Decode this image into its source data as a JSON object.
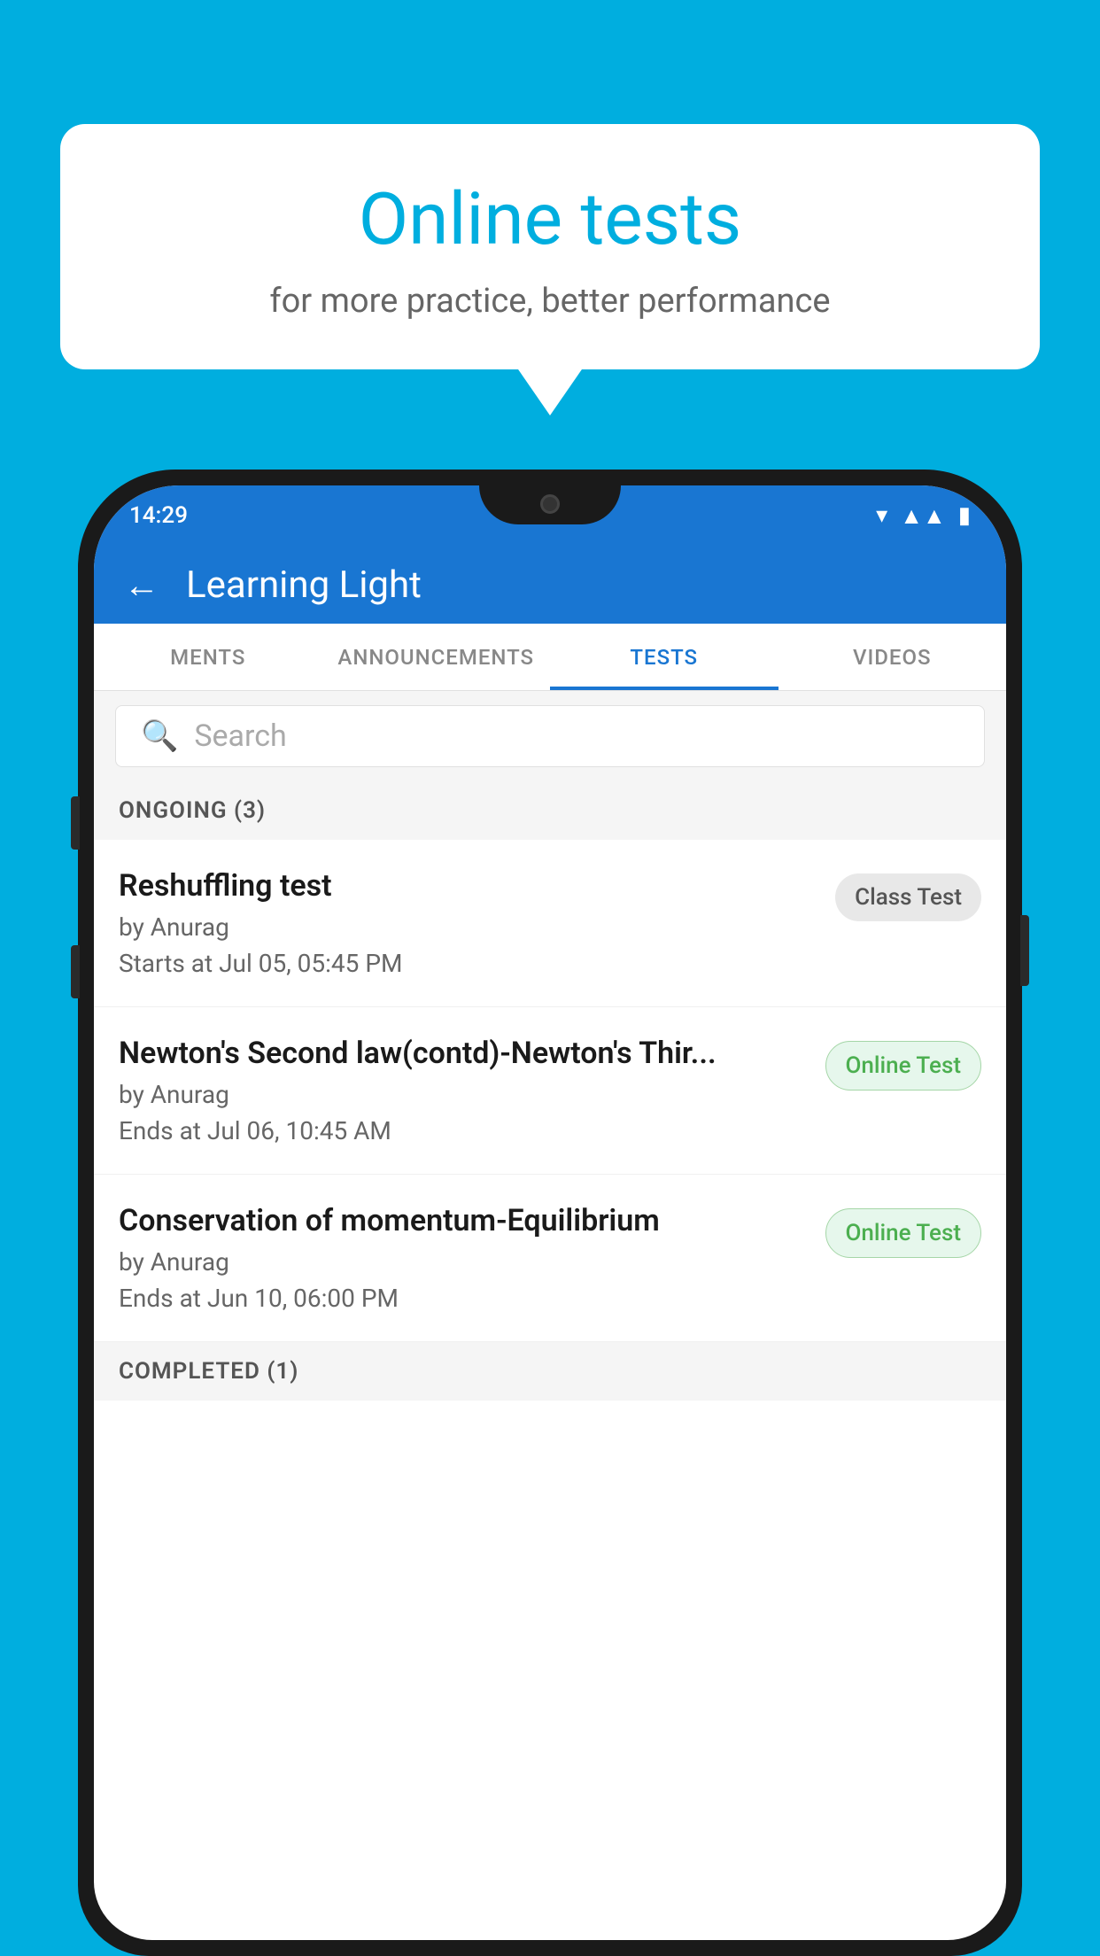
{
  "bubble": {
    "title": "Online tests",
    "subtitle": "for more practice, better performance"
  },
  "phone": {
    "status_time": "14:29",
    "app_title": "Learning Light",
    "tabs": [
      {
        "label": "MENTS",
        "active": false
      },
      {
        "label": "ANNOUNCEMENTS",
        "active": false
      },
      {
        "label": "TESTS",
        "active": true
      },
      {
        "label": "VIDEOS",
        "active": false
      }
    ],
    "search": {
      "placeholder": "Search"
    },
    "section_ongoing": "ONGOING (3)",
    "section_completed": "COMPLETED (1)",
    "tests": [
      {
        "name": "Reshuffling test",
        "author": "by Anurag",
        "time_label": "Starts at",
        "time_value": "Jul 05, 05:45 PM",
        "badge": "Class Test",
        "badge_type": "class"
      },
      {
        "name": "Newton's Second law(contd)-Newton's Thir...",
        "author": "by Anurag",
        "time_label": "Ends at",
        "time_value": "Jul 06, 10:45 AM",
        "badge": "Online Test",
        "badge_type": "online"
      },
      {
        "name": "Conservation of momentum-Equilibrium",
        "author": "by Anurag",
        "time_label": "Ends at",
        "time_value": "Jun 10, 06:00 PM",
        "badge": "Online Test",
        "badge_type": "online"
      }
    ]
  },
  "colors": {
    "background": "#00AEDF",
    "header_blue": "#1976D2",
    "bubble_title": "#00AEDF"
  }
}
